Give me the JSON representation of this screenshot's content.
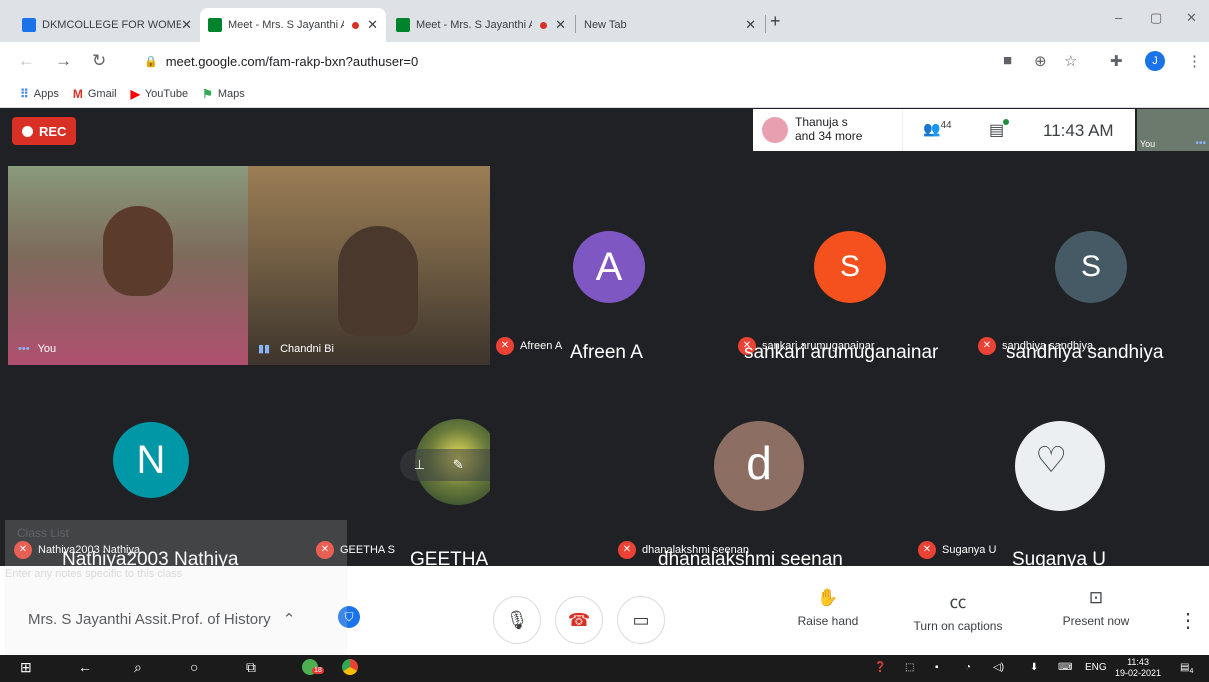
{
  "browser": {
    "tabs": [
      {
        "title": "DKMCOLLEGE FOR WOMEN -",
        "favicon_color": "#1a73e8",
        "active": false,
        "recording": false
      },
      {
        "title": "Meet - Mrs. S Jayanthi Ass",
        "favicon_color": "#00832d",
        "active": true,
        "recording": true
      },
      {
        "title": "Meet - Mrs. S Jayanthi Ass",
        "favicon_color": "#00832d",
        "active": false,
        "recording": true
      },
      {
        "title": "New Tab",
        "favicon_color": "",
        "active": false,
        "recording": false
      }
    ],
    "close_symbol": "✕",
    "new_tab_symbol": "+",
    "url": "meet.google.com/fam-rakp-bxn?authuser=0",
    "profile_initial": "J",
    "bookmarks": [
      {
        "label": "Apps",
        "icon": "apps-grid-icon"
      },
      {
        "label": "Gmail",
        "icon": "gmail-icon"
      },
      {
        "label": "YouTube",
        "icon": "youtube-icon"
      },
      {
        "label": "Maps",
        "icon": "maps-icon"
      }
    ]
  },
  "meet": {
    "rec_label": "REC",
    "joiners": {
      "line1": "Thanuja s",
      "line2": "and 34 more"
    },
    "people_count": "44",
    "clock": "11:43 AM",
    "self_thumb_label": "You",
    "tiles": [
      {
        "id": "you",
        "label": "You",
        "type": "video"
      },
      {
        "id": "chandni",
        "label": "Chandni Bi",
        "type": "video"
      },
      {
        "id": "afreen",
        "label": "Afreen A",
        "big": "Afreen A",
        "initial": "A",
        "color": "#7e57c2"
      },
      {
        "id": "sankari",
        "label": "sankari arumuganainar",
        "big": "sankari arumuganainar",
        "initial": "S",
        "color": "#f4511e"
      },
      {
        "id": "sandhiya",
        "label": "sandhiya sandhiya",
        "big": "sandhiya sandhiya",
        "initial": "S",
        "color": "#455a64"
      },
      {
        "id": "nathiya",
        "label": "Nathiya2003 Nathiya",
        "big": "Nathiya2003 Nathiya",
        "initial": "N",
        "color": "#0097a7"
      },
      {
        "id": "geetha",
        "label": "GEETHA S",
        "big": "GEETHA S",
        "initial": "",
        "color": "#6d7d3c"
      },
      {
        "id": "dhanalakshmi",
        "label": "dhanalakshmi seenan",
        "big": "dhanalakshmi seenan",
        "initial": "d",
        "color": "#8d6e63"
      },
      {
        "id": "suganya",
        "label": "Suganya U",
        "big": "Suganya U",
        "initial": "",
        "color": "#eceff1"
      }
    ],
    "overlay": {
      "header": "Class List",
      "notes": "Enter any notes specific to this class"
    }
  },
  "controls": {
    "meeting_title": "Mrs. S Jayanthi Assit.Prof. of History",
    "raise_hand": "Raise hand",
    "captions": "Turn on captions",
    "present": "Present now"
  },
  "taskbar": {
    "lang": "ENG",
    "time": "11:43",
    "date": "19-02-2021",
    "notification_count": "4",
    "badge_count": "18"
  }
}
